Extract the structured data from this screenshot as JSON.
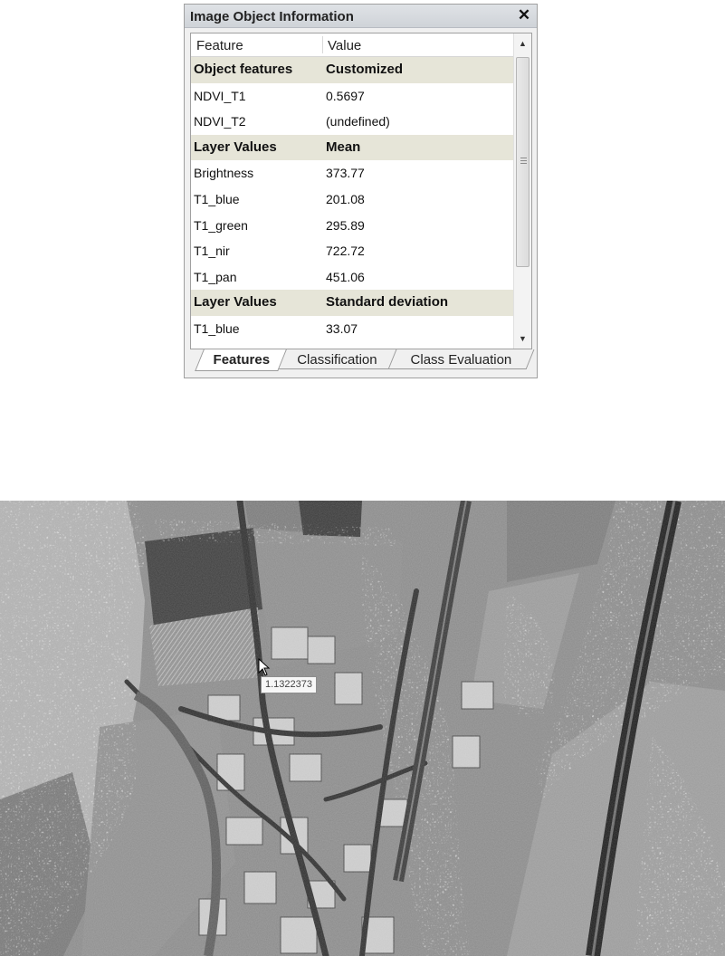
{
  "panel": {
    "title": "Image Object Information",
    "close_glyph": "✕",
    "columns": [
      "Feature",
      "Value"
    ],
    "rows": [
      {
        "feature": "Object features",
        "value": "Customized",
        "group": true
      },
      {
        "feature": "NDVI_T1",
        "value": "0.5697",
        "group": false
      },
      {
        "feature": "NDVI_T2",
        "value": "(undefined)",
        "group": false
      },
      {
        "feature": "Layer Values",
        "value": "Mean",
        "group": true
      },
      {
        "feature": "Brightness",
        "value": "373.77",
        "group": false
      },
      {
        "feature": "T1_blue",
        "value": "201.08",
        "group": false
      },
      {
        "feature": "T1_green",
        "value": "295.89",
        "group": false
      },
      {
        "feature": "T1_nir",
        "value": "722.72",
        "group": false
      },
      {
        "feature": "T1_pan",
        "value": "451.06",
        "group": false
      },
      {
        "feature": "Layer Values",
        "value": "Standard deviation",
        "group": true
      },
      {
        "feature": "T1_blue",
        "value": "33.07",
        "group": false
      }
    ],
    "tabs": [
      {
        "label": "Features",
        "active": true
      },
      {
        "label": "Classification",
        "active": false
      },
      {
        "label": "Class Evaluation",
        "active": false
      }
    ]
  },
  "image_view": {
    "tooltip_value": "1.1322373"
  },
  "colors": {
    "group_row_bg": "#e6e5d8",
    "titlebar_bg": "#d8dbe0"
  }
}
